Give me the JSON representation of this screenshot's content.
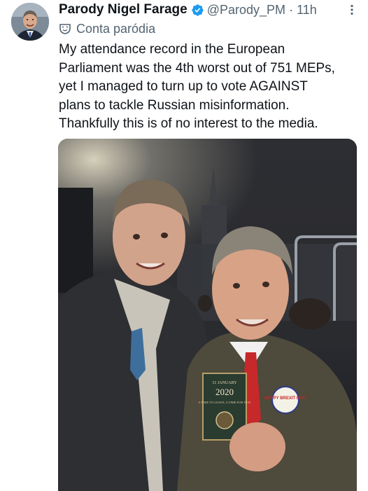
{
  "tweet": {
    "display_name": "Parody Nigel Farage",
    "handle": "@Parody_PM",
    "separator": "·",
    "time": "11h",
    "parody_label": "Conta paródia",
    "text": "My attendance record in the European\nParliament was the 4th worst out of 751 MEPs,\nyet I managed to turn up to vote AGAINST\nplans to tackle Russian misinformation.\nThankfully this is of no interest to the media."
  },
  "photo": {
    "card_date": "31 JANUARY",
    "card_year": "2020",
    "card_sub": "A TIME TO LEAVE, A TIME FOR NEW",
    "badge_text": "HAPPY BREXIT DAY!"
  },
  "colors": {
    "verified": "#1d9bf0",
    "muted": "#536471",
    "text": "#0f1419"
  },
  "icons": {
    "verified": "verified-badge-icon",
    "more": "more-icon",
    "parody": "parody-mask-icon"
  }
}
